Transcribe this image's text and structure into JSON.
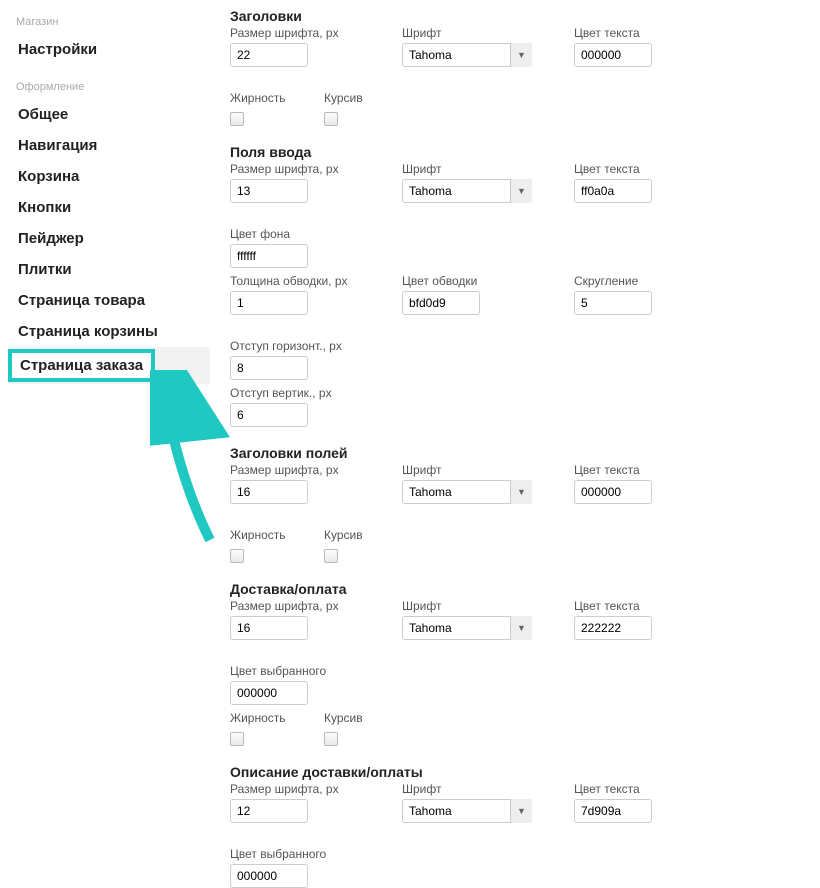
{
  "sidebar": {
    "group1_label": "Магазин",
    "items1": [
      "Настройки"
    ],
    "group2_label": "Оформление",
    "items2": [
      "Общее",
      "Навигация",
      "Корзина",
      "Кнопки",
      "Пейджер",
      "Плитки",
      "Страница товара",
      "Страница корзины",
      "Страница заказа"
    ],
    "active_index2": 8
  },
  "labels": {
    "font_size": "Размер шрифта, px",
    "font": "Шрифт",
    "text_color": "Цвет текста",
    "bold": "Жирность",
    "italic": "Курсив",
    "bg_color": "Цвет фона",
    "border_width": "Толщина обводки, px",
    "border_color": "Цвет обводки",
    "radius": "Скругление",
    "pad_h": "Отступ горизонт., px",
    "pad_v": "Отступ вертик., px",
    "selected_color": "Цвет выбранного"
  },
  "sections": {
    "headers": {
      "title": "Заголовки",
      "size": "22",
      "font": "Tahoma",
      "color": "000000"
    },
    "inputs": {
      "title": "Поля ввода",
      "size": "13",
      "font": "Tahoma",
      "color": "ff0a0a",
      "bg": "ffffff",
      "border_w": "1",
      "border_c": "bfd0d9",
      "radius": "5",
      "pad_h": "8",
      "pad_v": "6"
    },
    "field_headers": {
      "title": "Заголовки полей",
      "size": "16",
      "font": "Tahoma",
      "color": "000000"
    },
    "delivery": {
      "title": "Доставка/оплата",
      "size": "16",
      "font": "Tahoma",
      "color": "222222",
      "selected": "000000"
    },
    "delivery_desc": {
      "title": "Описание доставки/оплаты",
      "size": "12",
      "font": "Tahoma",
      "color": "7d909a",
      "selected": "000000"
    }
  }
}
